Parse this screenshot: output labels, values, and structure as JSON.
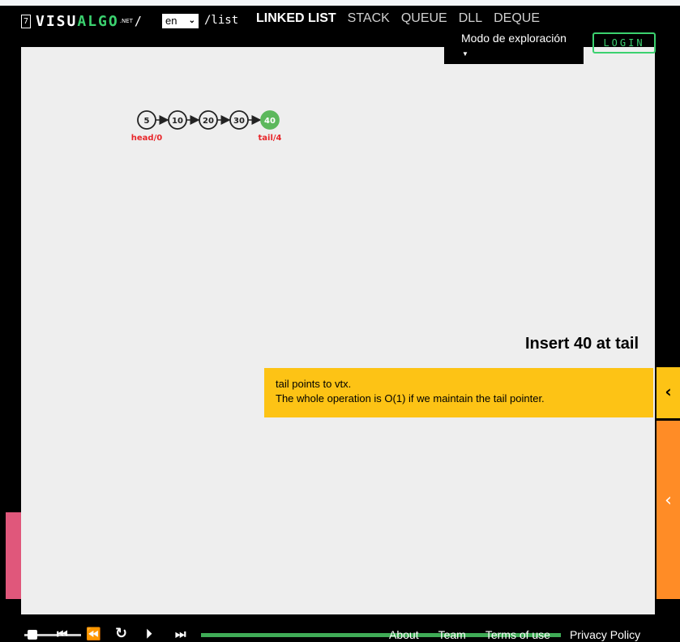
{
  "header": {
    "logo_badge": "7",
    "logo_visu": "VISU",
    "logo_algo": "ALGO",
    "logo_net": ".NET",
    "logo_slash": "/",
    "language": "en",
    "path": "/list",
    "nav": [
      "LINKED LIST",
      "STACK",
      "QUEUE",
      "DLL",
      "DEQUE"
    ],
    "active_nav": "LINKED LIST",
    "mode_label": "Modo de exploración",
    "login_label": "LOGIN"
  },
  "list": {
    "nodes": [
      "5",
      "10",
      "20",
      "30",
      "40"
    ],
    "head_label": "head/0",
    "tail_label": "tail/4",
    "highlight_color": "#5cb85c",
    "label_color": "#e8262a"
  },
  "status": {
    "title": "Insert 40 at tail",
    "line1": "tail points to vtx.",
    "line2": "The whole operation is O(1) if we maintain the tail pointer."
  },
  "footer": {
    "links": [
      "About",
      "Team",
      "Terms of use",
      "Privacy Policy"
    ]
  },
  "icons": {
    "collapse": "‹",
    "first": "⏮",
    "back": "⏪",
    "replay": "↻",
    "forward": "⏵",
    "last": "⏭"
  },
  "colors": {
    "accent_green": "#3bd16f",
    "status_yellow": "#fdc315",
    "panel_orange": "#ff8c26",
    "panel_pink": "#e0577b",
    "canvas_bg": "#eeeeee"
  }
}
